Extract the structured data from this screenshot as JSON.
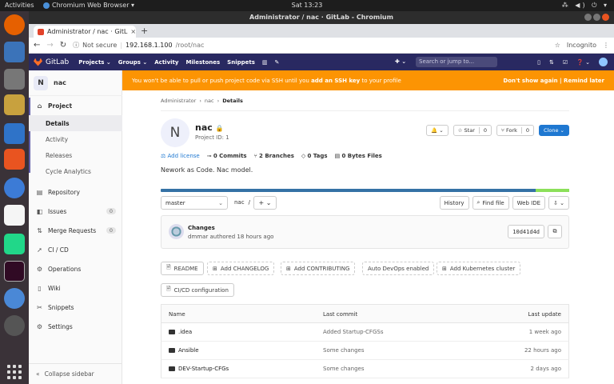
{
  "os": {
    "activities": "Activities",
    "app_name": "Chromium Web Browser ▾",
    "clock": "Sat 13:23",
    "tray": "⁂ ◀) ⏻ ▾"
  },
  "window": {
    "title": "Administrator / nac · GitLab - Chromium",
    "tab_title": "Administrator / nac · GitL",
    "tab_close": "×",
    "new_tab": "+",
    "security": "Not secure",
    "url_host": "192.168.1.100",
    "url_path": "/root/nac",
    "incognito": "Incognito"
  },
  "gitlab_nav": {
    "brand": "GitLab",
    "links": [
      "Projects ⌄",
      "Groups ⌄",
      "Activity",
      "Milestones",
      "Snippets"
    ],
    "search_placeholder": "Search or jump to...",
    "plus": "✚ ⌄",
    "help": "❓ ⌄"
  },
  "banner": {
    "msg_pre": "You won't be able to pull or push project code via SSH until you ",
    "msg_link": "add an SSH key",
    "msg_post": " to your profile",
    "actions": "Don't show again | Remind later"
  },
  "sidebar": {
    "project_avatar": "N",
    "project_name": "nac",
    "section": "Project",
    "sub": [
      "Details",
      "Activity",
      "Releases",
      "Cycle Analytics"
    ],
    "items": [
      {
        "label": "Repository",
        "icon": "▤"
      },
      {
        "label": "Issues",
        "icon": "◧",
        "count": "0"
      },
      {
        "label": "Merge Requests",
        "icon": "⇅",
        "count": "0"
      },
      {
        "label": "CI / CD",
        "icon": "🚀"
      },
      {
        "label": "Operations",
        "icon": "⚙"
      },
      {
        "label": "Wiki",
        "icon": "▯"
      },
      {
        "label": "Snippets",
        "icon": "✂"
      },
      {
        "label": "Settings",
        "icon": "⚙"
      }
    ],
    "collapse": "Collapse sidebar"
  },
  "breadcrumb": [
    "Administrator",
    "nac",
    "Details"
  ],
  "project": {
    "avatar": "N",
    "name": "nac",
    "id_text": "Project ID: 1",
    "notify": "🔔 ⌄",
    "star": "☆ Star",
    "star_count": "0",
    "fork": "⑂ Fork",
    "fork_count": "0",
    "clone": "Clone ⌄",
    "add_license": "Add license",
    "commits": "0 Commits",
    "branches": "2 Branches",
    "tags": "0 Tags",
    "bytes": "0 Bytes Files",
    "description": "Nework as Code. Nac model."
  },
  "tree": {
    "branch": "master",
    "path": "nac",
    "plus": "+ ⌄",
    "history": "History",
    "find_file": "Find file",
    "web_ide": "Web IDE",
    "clone_dd": "⇩ ⌄"
  },
  "commit": {
    "title": "Changes",
    "author_line": "dmmar authored 18 hours ago",
    "sha": "10d41d4d",
    "copy": "⧉"
  },
  "quick_buttons": [
    "README",
    "Add CHANGELOG",
    "Add CONTRIBUTING",
    "Auto DevOps enabled",
    "Add Kubernetes cluster",
    "CI/CD configuration"
  ],
  "files": {
    "headers": [
      "Name",
      "Last commit",
      "Last update"
    ],
    "rows": [
      {
        "name": ".idea",
        "commit": "Added Startup-CFGSs",
        "updated": "1 week ago"
      },
      {
        "name": "Ansible",
        "commit": "Some changes",
        "updated": "22 hours ago"
      },
      {
        "name": "DEV-Startup-CFGs",
        "commit": "Some changes",
        "updated": "2 days ago"
      }
    ]
  }
}
